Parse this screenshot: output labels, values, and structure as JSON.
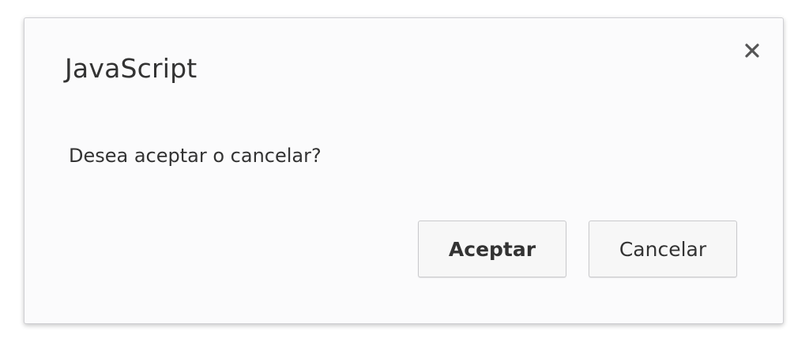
{
  "dialog": {
    "title": "JavaScript",
    "message": "Desea aceptar o cancelar?",
    "close_icon": "close-icon",
    "buttons": {
      "accept_label": "Aceptar",
      "cancel_label": "Cancelar"
    }
  },
  "colors": {
    "dialog_background": "#fbfbfc",
    "dialog_border": "#cfcfd3",
    "text": "#333333",
    "button_background": "#f7f7f7",
    "button_border": "#c9c9cc"
  }
}
